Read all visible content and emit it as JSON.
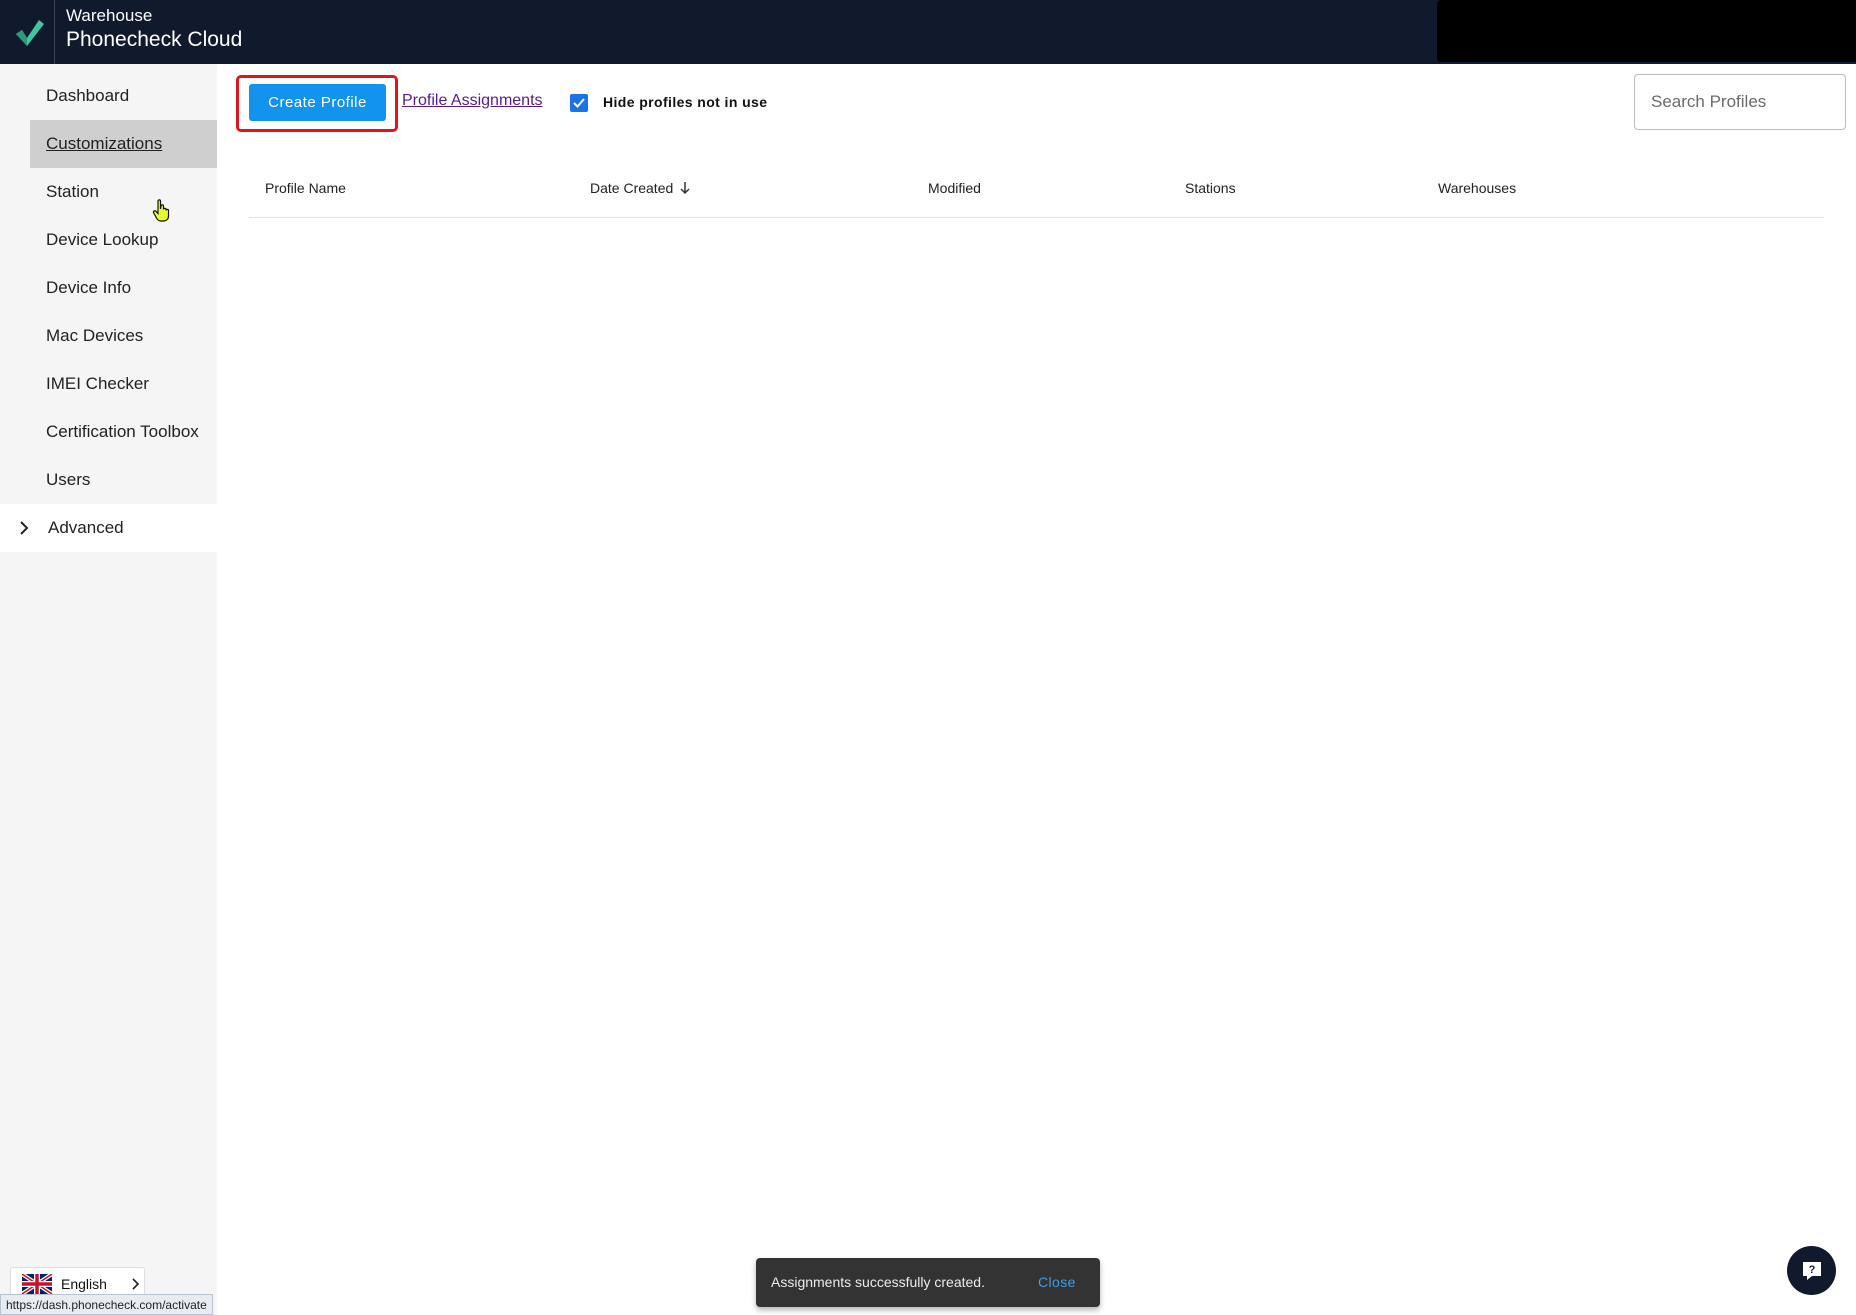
{
  "header": {
    "subtitle": "Warehouse",
    "title": "Phonecheck Cloud"
  },
  "sidebar": {
    "items": [
      {
        "label": "Dashboard"
      },
      {
        "label": "Customizations"
      },
      {
        "label": "Station"
      },
      {
        "label": "Device Lookup"
      },
      {
        "label": "Device Info"
      },
      {
        "label": "Mac Devices"
      },
      {
        "label": "IMEI Checker"
      },
      {
        "label": "Certification Toolbox"
      },
      {
        "label": "Users"
      }
    ],
    "active_item": "Customizations",
    "advanced_label": "Advanced"
  },
  "language": {
    "label": "English"
  },
  "status_url": "https://dash.phonecheck.com/activate",
  "toolbar": {
    "create_label": "Create Profile",
    "assignments_label": "Profile Assignments",
    "hide_label": "Hide profiles not in use",
    "hide_checked": true,
    "search_placeholder": "Search Profiles",
    "search_value": ""
  },
  "table": {
    "columns": [
      "Profile Name",
      "Date Created",
      "Modified",
      "Stations",
      "Warehouses"
    ],
    "sort_column": "Date Created",
    "rows": []
  },
  "snackbar": {
    "message": "Assignments successfully created.",
    "action": "Close"
  },
  "colors": {
    "topbar": "#111a2c",
    "primary": "#1193ee",
    "highlight": "#e0141e",
    "link": "#5a1a8c",
    "logo": "#3ec7a0"
  },
  "icons": {
    "logo": "checkmark-logo-icon",
    "advanced": "chevron-right-icon",
    "sort": "arrow-down-icon",
    "help": "help-chat-icon",
    "flag": "uk-flag-icon"
  }
}
